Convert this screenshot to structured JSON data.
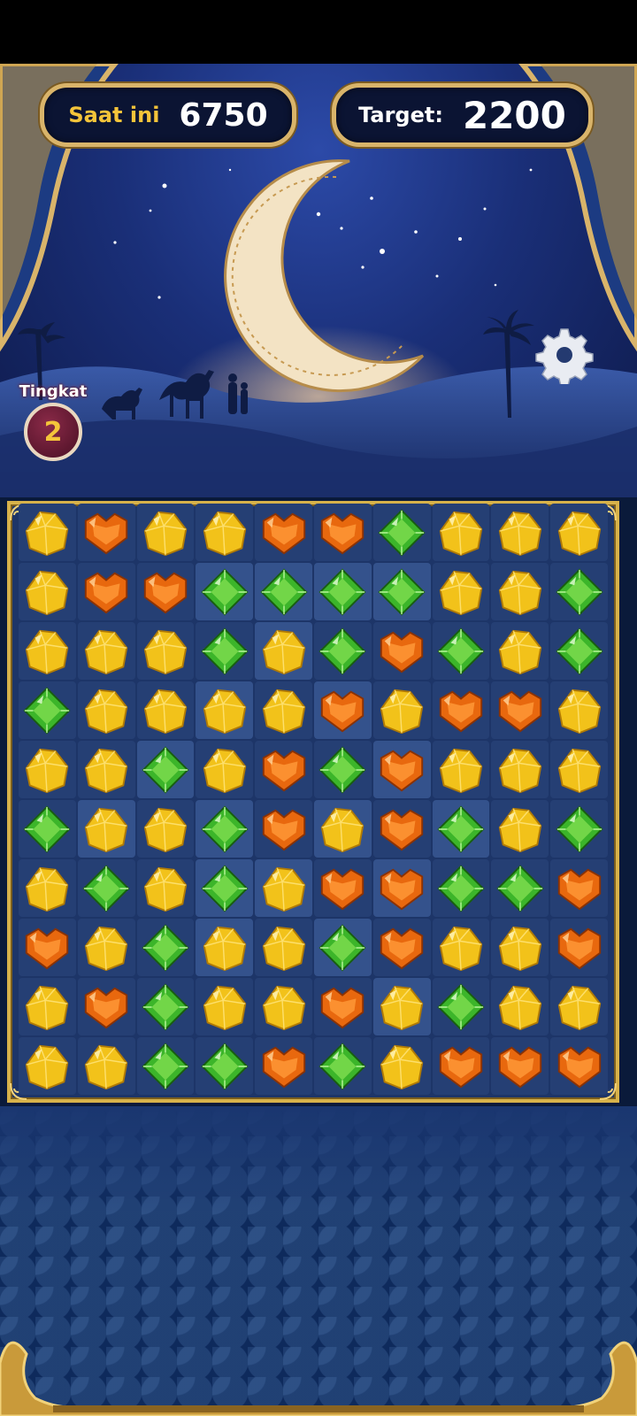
{
  "score": {
    "current_label": "Saat ini",
    "current_value": "6750",
    "target_label": "Target:",
    "target_value": "2200"
  },
  "level": {
    "label": "Tingkat",
    "value": "2"
  },
  "settings": {
    "icon": "gear-icon"
  },
  "colors": {
    "yellow": "#f2c21a",
    "orange": "#e8680e",
    "green": "#3cb52a",
    "gold_frame": "#d7b24a"
  },
  "board": {
    "rows": [
      [
        "Y",
        "O",
        "Y",
        "Y",
        "O",
        "O",
        "G",
        "Y",
        "Y",
        "Y"
      ],
      [
        "Y",
        "O",
        "O",
        "G",
        "G",
        "G",
        "G",
        "Y",
        "Y",
        "G"
      ],
      [
        "Y",
        "Y",
        "Y",
        "G",
        "Y",
        "G",
        "O",
        "G",
        "Y",
        "G"
      ],
      [
        "G",
        "Y",
        "Y",
        "Y",
        "Y",
        "O",
        "Y",
        "O",
        "O",
        "Y"
      ],
      [
        "Y",
        "Y",
        "G",
        "Y",
        "O",
        "G",
        "O",
        "Y",
        "Y",
        "Y"
      ],
      [
        "G",
        "Y",
        "Y",
        "G",
        "O",
        "Y",
        "O",
        "G",
        "Y",
        "G"
      ],
      [
        "Y",
        "G",
        "Y",
        "G",
        "Y",
        "O",
        "O",
        "G",
        "G",
        "O"
      ],
      [
        "O",
        "Y",
        "G",
        "Y",
        "Y",
        "G",
        "O",
        "Y",
        "Y",
        "O"
      ],
      [
        "Y",
        "O",
        "G",
        "Y",
        "Y",
        "O",
        "Y",
        "G",
        "Y",
        "Y"
      ],
      [
        "Y",
        "Y",
        "G",
        "G",
        "O",
        "G",
        "Y",
        "O",
        "O",
        "O"
      ]
    ]
  }
}
